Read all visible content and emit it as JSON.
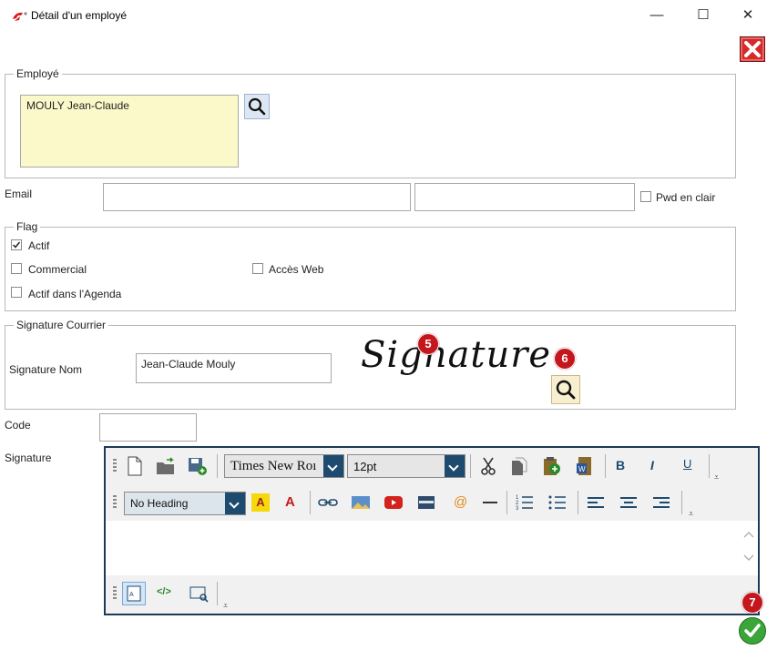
{
  "window": {
    "title": "Détail d'un employé",
    "minimize_glyph": "—",
    "maximize_glyph": "☐",
    "close_glyph": "✕"
  },
  "employe": {
    "legend": "Employé",
    "name": "MOULY Jean-Claude"
  },
  "email": {
    "label": "Email",
    "value": "",
    "password": "",
    "pwd_label": "Pwd en clair",
    "pwd_checked": false
  },
  "flag": {
    "legend": "Flag",
    "actif": {
      "label": "Actif",
      "checked": true
    },
    "commercial": {
      "label": "Commercial",
      "checked": false
    },
    "acces_web": {
      "label": "Accès Web",
      "checked": false
    },
    "agenda": {
      "label": "Actif dans l'Agenda",
      "checked": false
    }
  },
  "signature_courrier": {
    "legend": "Signature Courrier",
    "nom_label": "Signature Nom",
    "nom_value": "Jean-Claude Mouly",
    "image_text": "Signature"
  },
  "code": {
    "label": "Code",
    "value": ""
  },
  "signature": {
    "label": "Signature"
  },
  "editor": {
    "font_family": "Times New Roı",
    "font_size": "12pt",
    "bold": "B",
    "italic": "I",
    "underline": "U",
    "heading": "No Heading",
    "highlight_glyph": "A",
    "fontcolor_glyph": "A",
    "email_glyph": "@",
    "code_glyph": "</>",
    "more_glyph": "⩡",
    "content": ""
  },
  "badges": {
    "b5": "5",
    "b6": "6",
    "b7": "7"
  },
  "colors": {
    "employe_bg": "#fbf9c9",
    "accent_dark": "#1b3a57",
    "red": "#c4161c",
    "green": "#3aa63a"
  }
}
